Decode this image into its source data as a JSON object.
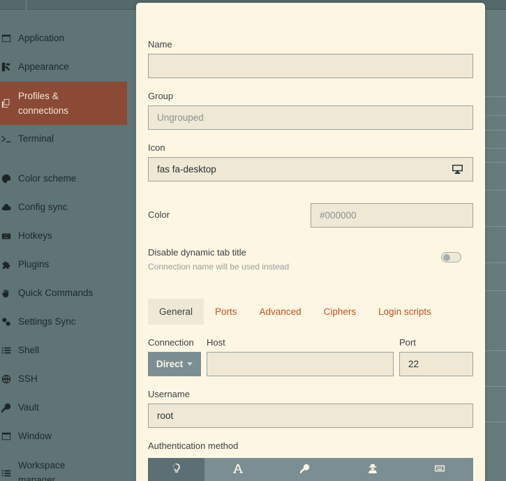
{
  "sidebar": {
    "items": [
      {
        "label": "Application",
        "icon": "window-icon"
      },
      {
        "label": "Appearance",
        "icon": "paint-brush-icon"
      },
      {
        "label": "Profiles & connections",
        "icon": "copy-icon",
        "active": true
      },
      {
        "label": "Terminal",
        "icon": "terminal-icon"
      },
      {
        "label": "Color scheme",
        "icon": "palette-icon"
      },
      {
        "label": "Config sync",
        "icon": "cloud-icon"
      },
      {
        "label": "Hotkeys",
        "icon": "keyboard-icon"
      },
      {
        "label": "Plugins",
        "icon": "puzzle-icon"
      },
      {
        "label": "Quick Commands",
        "icon": "hand-icon"
      },
      {
        "label": "Settings Sync",
        "icon": "cogs-icon"
      },
      {
        "label": "Shell",
        "icon": "list-icon"
      },
      {
        "label": "SSH",
        "icon": "globe-icon"
      },
      {
        "label": "Vault",
        "icon": "key-icon"
      },
      {
        "label": "Window",
        "icon": "window-icon"
      },
      {
        "label": "Workspace manager",
        "icon": "list-icon"
      }
    ]
  },
  "modal": {
    "name": {
      "label": "Name",
      "value": ""
    },
    "group": {
      "label": "Group",
      "placeholder": "Ungrouped"
    },
    "icon": {
      "label": "Icon",
      "value": "fas fa-desktop",
      "addon_icon": "desktop-icon"
    },
    "color": {
      "label": "Color",
      "placeholder": "#000000"
    },
    "dynamic_title": {
      "label": "Disable dynamic tab title",
      "hint": "Connection name will be used instead",
      "enabled": false
    },
    "tabs": [
      {
        "label": "General",
        "active": true
      },
      {
        "label": "Ports"
      },
      {
        "label": "Advanced"
      },
      {
        "label": "Ciphers"
      },
      {
        "label": "Login scripts"
      }
    ],
    "connection": {
      "label": "Connection",
      "value": "Direct"
    },
    "host": {
      "label": "Host",
      "value": ""
    },
    "port": {
      "label": "Port",
      "value": "22"
    },
    "username": {
      "label": "Username",
      "value": "root"
    },
    "auth": {
      "label": "Authentication method",
      "options": [
        "lightbulb-icon",
        "font-icon",
        "key-icon",
        "user-secret-icon",
        "keyboard-icon"
      ]
    }
  },
  "colors": {
    "accent": "#c4501e",
    "sidebar_active": "#8a4a35",
    "modal_bg": "#fdf6e3",
    "input_bg": "#eee8d5"
  }
}
